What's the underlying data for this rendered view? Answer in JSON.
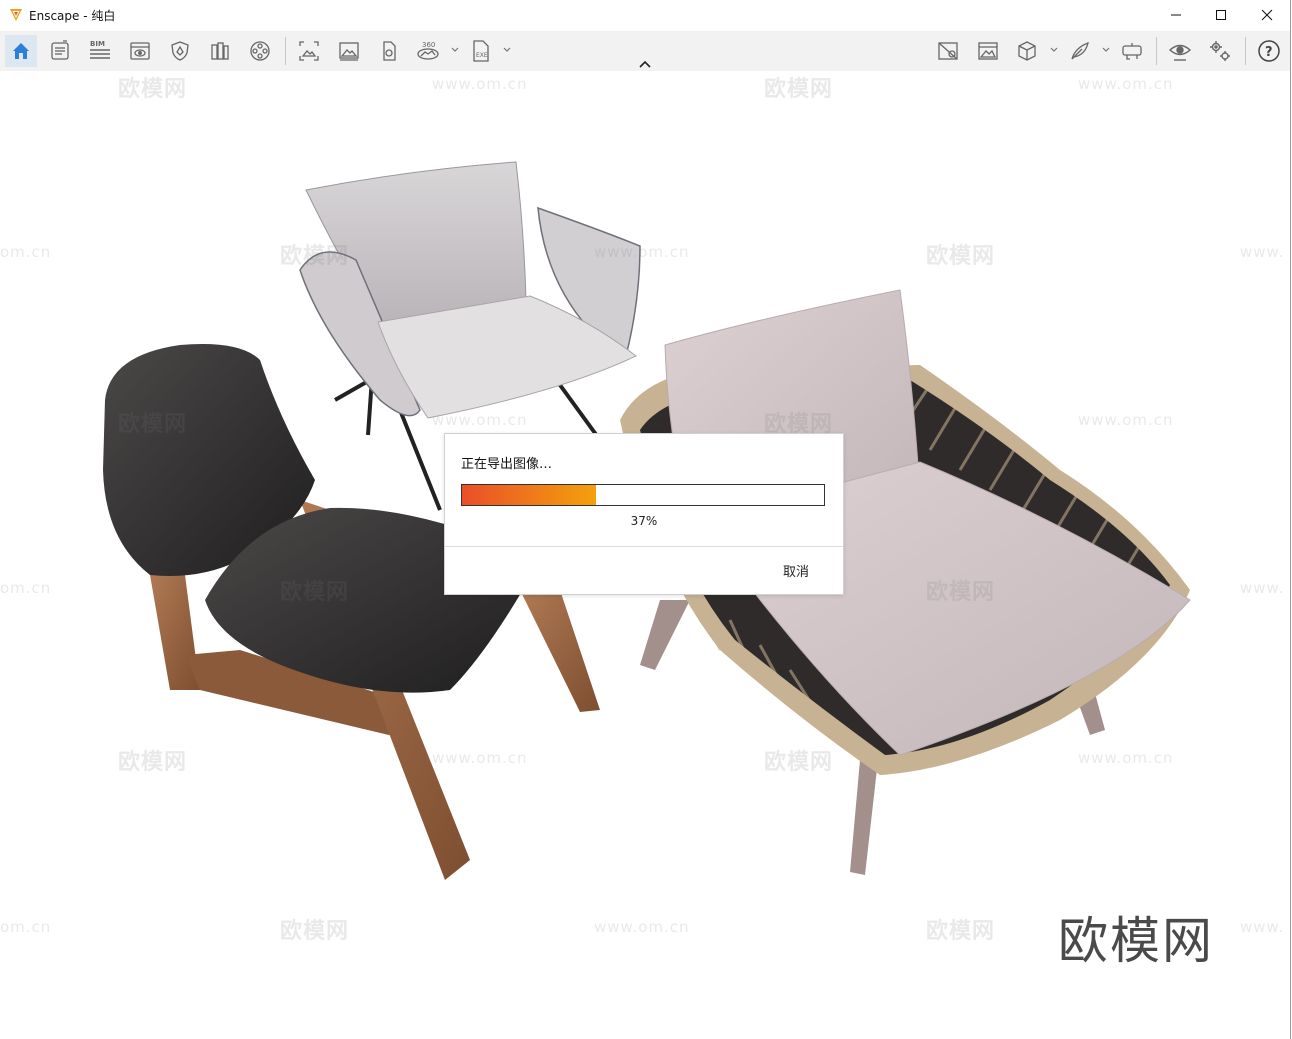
{
  "window": {
    "app_name": "Enscape",
    "separator": " - ",
    "document": "纯白",
    "controls": {
      "minimize": "minimize-icon",
      "maximize": "maximize-icon",
      "close": "close-icon"
    }
  },
  "toolbar": {
    "bim_label": "BIM",
    "panorama_label": "360",
    "exe_label": "EXE",
    "left_icons": [
      "home-icon",
      "project-notes-icon",
      "bim-icon",
      "visual-settings-icon",
      "shield-icon",
      "books-icon",
      "video-reel-icon",
      "screenshot-icon",
      "batch-render-icon",
      "asset-icon",
      "panorama-icon",
      "exe-export-icon"
    ],
    "right_icons": [
      "no-image-icon",
      "views-icon",
      "cube-icon",
      "feather-icon",
      "vr-headset-icon",
      "eye-icon",
      "gears-icon",
      "help-icon"
    ]
  },
  "dialog": {
    "title": "正在导出图像…",
    "progress": 0.37,
    "progress_text": "37%",
    "cancel_label": "取消",
    "colors": {
      "progress_start": "#ea4f28",
      "progress_end": "#f3a10c"
    }
  },
  "watermarks": {
    "text": "欧模网",
    "url_text": "www.om.cn",
    "url_fragment_left": "om.cn",
    "url_fragment_right": "www."
  },
  "brand_mark": "欧模网"
}
